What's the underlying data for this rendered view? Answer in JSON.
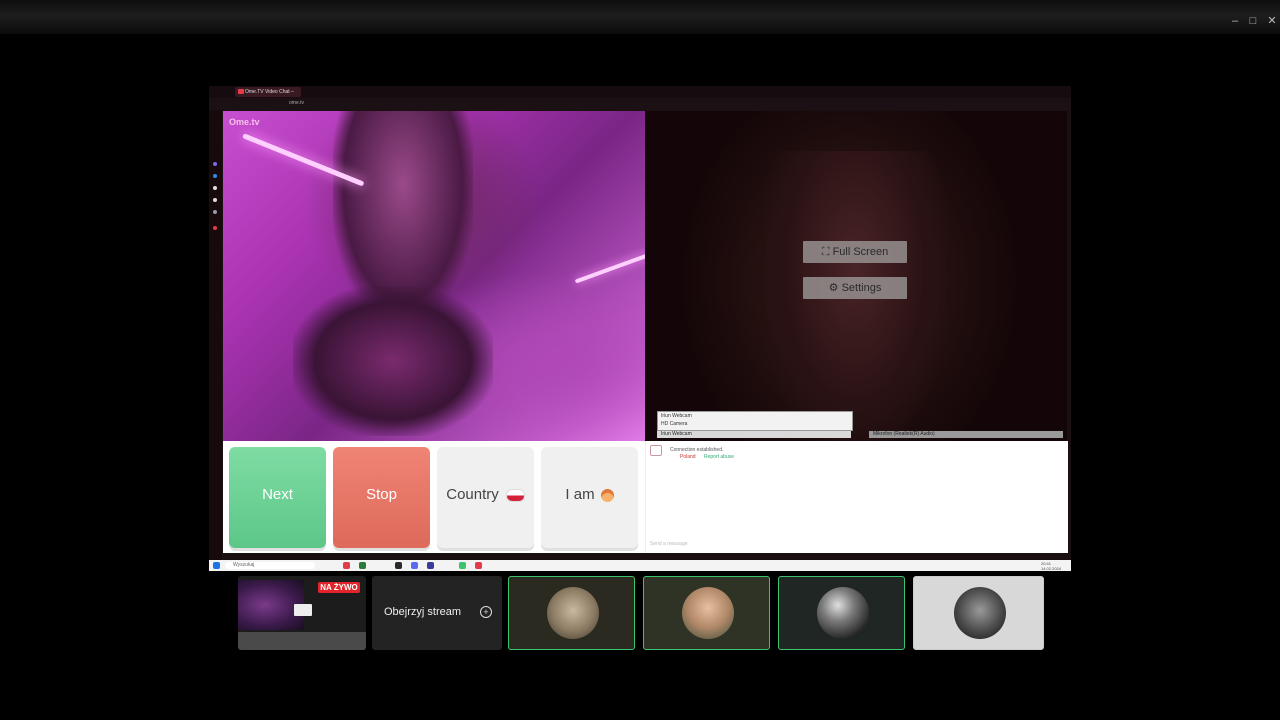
{
  "inner_browser": {
    "tab_title": "Ome.TV Video Chat –",
    "url": "ome.tv"
  },
  "left_video": {
    "logo": "Ome.tv"
  },
  "overlay": {
    "fullscreen_label": "Full Screen",
    "settings_label": "Settings"
  },
  "devices": {
    "camera_options": [
      "Iriun Webcam",
      "HD Camera"
    ],
    "camera_selected": "Iriun Webcam",
    "microphone_selected": "Mikrofon (Realtek(R) Audio)"
  },
  "controls": {
    "next_label": "Next",
    "stop_label": "Stop",
    "country_label": "Country",
    "iam_label": "I am"
  },
  "chat": {
    "status": "Connection established.",
    "country": "Poland",
    "report": "Report abuse",
    "input_placeholder": "Send a message"
  },
  "taskbar": {
    "search_placeholder": "Wyszukaj",
    "time": "20:41",
    "date": "14.02.2024"
  },
  "stream_strip": {
    "live_badge": "NA ŻYWO",
    "watch_label": "Obejrzyj stream"
  },
  "colors": {
    "next": "#5cc788",
    "stop": "#dd6a5a",
    "live": "#e3242b",
    "avatar_border": "#3cc46c"
  }
}
